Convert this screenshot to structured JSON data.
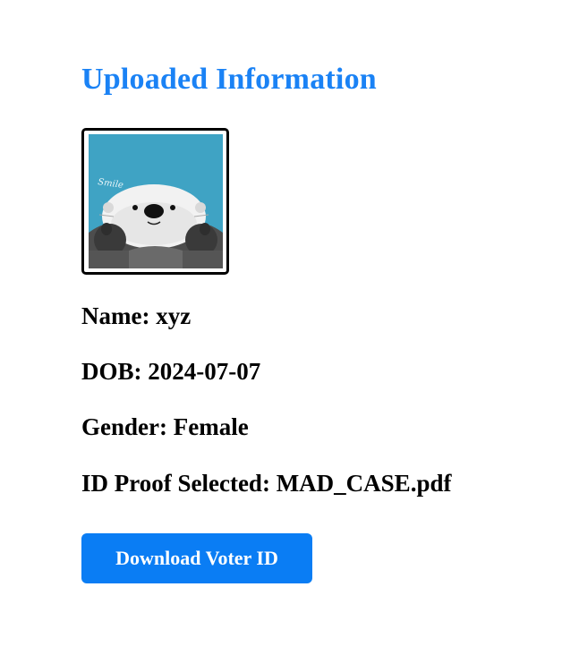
{
  "header": {
    "title": "Uploaded Information"
  },
  "photo": {
    "icon": "otter-photo",
    "caption": "Smile"
  },
  "fields": {
    "name_label": "Name:",
    "name_value": "xyz",
    "dob_label": "DOB:",
    "dob_value": "2024-07-07",
    "gender_label": "Gender:",
    "gender_value": "Female",
    "id_proof_label": "ID Proof Selected:",
    "id_proof_value": "MAD_CASE.pdf"
  },
  "actions": {
    "download_label": "Download Voter ID"
  },
  "colors": {
    "title": "#1a82f5",
    "button": "#0a7df4",
    "photo_background": "#3fa3c4"
  }
}
